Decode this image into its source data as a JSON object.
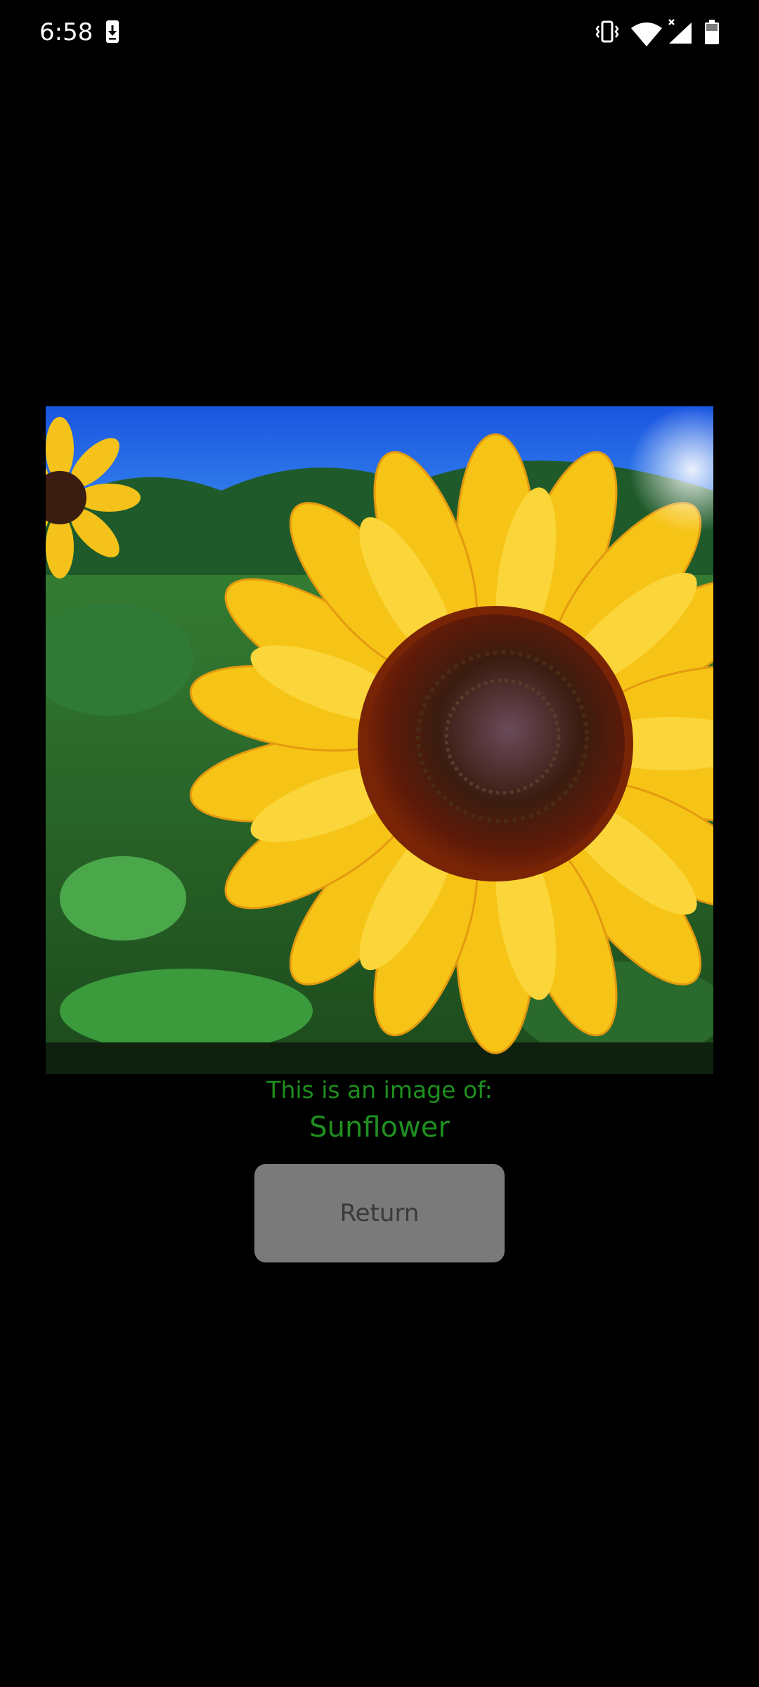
{
  "status_bar": {
    "time": "6:58",
    "icons": [
      "download-notification-icon",
      "vibrate-icon",
      "wifi-icon",
      "signal-icon",
      "battery-icon"
    ]
  },
  "main_image": {
    "subject": "sunflower-photo"
  },
  "caption": {
    "label": "This is an image of:",
    "result": "Sunflower",
    "color": "#1f8f1f"
  },
  "return_button": {
    "label": "Return",
    "background": "#7a7a7a"
  }
}
